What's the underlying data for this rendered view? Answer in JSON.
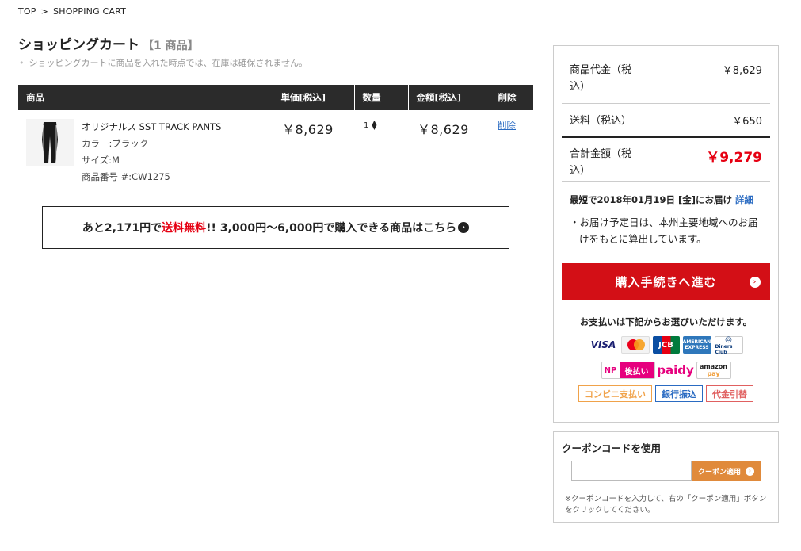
{
  "breadcrumb": {
    "top": "TOP",
    "separator": ">",
    "current": "SHOPPING CART"
  },
  "page": {
    "title": "ショッピングカート",
    "count": "【1 商品】",
    "note": "ショッピングカートに商品を入れた時点では、在庫は確保されません。"
  },
  "table": {
    "headers": {
      "product": "商品",
      "unit_price": "単価[税込]",
      "qty": "数量",
      "amount": "金額[税込]",
      "delete": "削除"
    },
    "item": {
      "name": "オリジナルス SST TRACK PANTS",
      "color": "カラー:ブラック",
      "size": "サイズ:M",
      "code": "商品番号 #:CW1275",
      "unit_price": "￥8,629",
      "qty": "1",
      "amount": "￥8,629",
      "delete": "削除"
    }
  },
  "promo": {
    "prefix": "あと2,171円で",
    "highlight": "送料無料",
    "suffix": "!! 3,000円〜6,000円で購入できる商品はこちら",
    "arrow": "›"
  },
  "summary": {
    "subtotal_label_1": "商品代金（税",
    "subtotal_label_2": "込）",
    "subtotal_value": "￥8,629",
    "shipping_label": "送料（税込）",
    "shipping_value": "￥650",
    "total_label_1": "合計金額（税",
    "total_label_2": "込）",
    "total_value": "￥9,279",
    "delivery": "最短で2018年01月19日 [金]にお届け",
    "delivery_link": "詳細",
    "delivery_note": "・お届け予定日は、本州主要地域へのお届けをもとに算出しています。",
    "buy_button": "購入手続きへ進む",
    "payment_title": "お支払いは下記からお選びいただけます。",
    "payment_logos": {
      "visa": "VISA",
      "mastercard": "MasterCard",
      "jcb": "JCB",
      "amex": "AMERICAN EXPRESS",
      "diners": "Diners Club",
      "np_brand": "NP",
      "np": "後払い",
      "paidy": "paidy",
      "amazon_1": "amazon",
      "amazon_2": "pay"
    },
    "payment_tags": {
      "convenience": "コンビニ支払い",
      "bank": "銀行振込",
      "cod": "代金引替"
    }
  },
  "coupon": {
    "title": "クーポンコードを使用",
    "input_value": "",
    "button": "クーポン適用",
    "note": "※クーポンコードを入力して、右の「クーポン適用」ボタンをクリックしてください。"
  },
  "colors": {
    "accent_red": "#d30f16",
    "price_red": "#e60012",
    "link_blue": "#2a6bc2",
    "coupon_orange": "#e08a3b",
    "header_dark": "#2b2b2b"
  }
}
